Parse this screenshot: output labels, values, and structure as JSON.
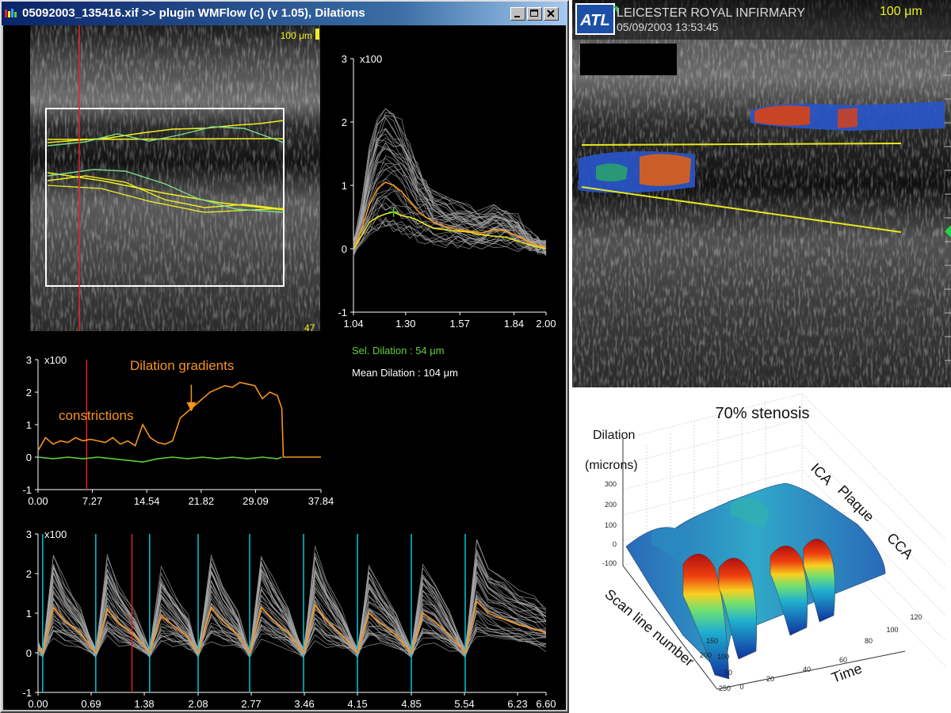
{
  "window": {
    "title": "05092003_135416.xif >> plugin WMFlow (c) (v 1.05), Dilations",
    "buttons": [
      "minimize",
      "maximize",
      "close"
    ]
  },
  "main_image": {
    "scale_label": "100 μm",
    "frame_number": "47"
  },
  "right_image": {
    "hospital": "LEICESTER ROYAL INFIRMARY",
    "datetime": "05/09/2003 13:53:45",
    "scale_label": "100 μm",
    "logo": "ATL"
  },
  "stats": {
    "selected": "Sel. Dilation : 54 μm",
    "mean": "Mean Dilation : 104 μm"
  },
  "annotations": {
    "gradients": "Dilation gradients",
    "constrictions": "constrictions"
  },
  "surface": {
    "title": "70% stenosis",
    "zlabel_line1": "Dilation",
    "zlabel_line2": "(microns)",
    "xlabel": "Scan line number",
    "ylabel": "Time",
    "region_labels": [
      "ICA",
      "Plaque",
      "CCA"
    ],
    "z_ticks": [
      "300",
      "200",
      "100",
      "0",
      "-100"
    ],
    "x_ticks": [
      "0",
      "50",
      "100",
      "150",
      "200",
      "250"
    ],
    "y_ticks": [
      "0",
      "20",
      "40",
      "60",
      "80",
      "100",
      "120"
    ]
  },
  "colors": {
    "mean_curve": "#f7931e",
    "selected_curve": "#e8e81e",
    "gate_line": "#e52222",
    "beat_marker": "#00c8d8",
    "baseline_curve": "#5fcf3a"
  },
  "chart_data": [
    {
      "type": "line",
      "axis_multiplier": "x100",
      "x_ticks": [
        "1.04",
        "1.30",
        "1.57",
        "1.84",
        "2.00"
      ],
      "y_ticks": [
        "3",
        "2",
        "1",
        "0",
        "-1"
      ],
      "xlim": [
        1.04,
        2.0
      ],
      "ylim": [
        -1,
        3
      ],
      "series": [
        {
          "x": [
            1.04,
            1.08,
            1.12,
            1.16,
            1.2,
            1.24,
            1.28,
            1.32,
            1.36,
            1.4,
            1.44,
            1.5,
            1.56,
            1.62,
            1.68,
            1.74,
            1.8,
            1.86,
            1.92,
            1.96,
            2.0
          ],
          "values": [
            0,
            0.3,
            0.7,
            0.95,
            1.05,
            1.0,
            0.9,
            0.75,
            0.6,
            0.5,
            0.42,
            0.35,
            0.3,
            0.28,
            0.25,
            0.3,
            0.28,
            0.2,
            0.1,
            0.05,
            0.02
          ]
        },
        {
          "x": [
            1.04,
            1.08,
            1.12,
            1.16,
            1.2,
            1.24,
            1.28,
            1.32,
            1.36,
            1.4,
            1.44,
            1.5,
            1.56,
            1.62,
            1.68,
            1.74,
            1.8,
            1.86,
            1.92,
            1.96,
            2.0
          ],
          "values": [
            0,
            0.2,
            0.42,
            0.5,
            0.55,
            0.58,
            0.52,
            0.5,
            0.45,
            0.38,
            0.32,
            0.3,
            0.28,
            0.26,
            0.22,
            0.2,
            0.18,
            0.12,
            0.06,
            0.03,
            0.0
          ]
        }
      ]
    },
    {
      "type": "line",
      "axis_multiplier": "x100",
      "x_ticks": [
        "0.00",
        "7.27",
        "14.54",
        "21.82",
        "29.09",
        "37.84"
      ],
      "y_ticks": [
        "3",
        "2",
        "1",
        "0",
        "-1"
      ],
      "xlim": [
        0,
        37.84
      ],
      "ylim": [
        -1,
        3
      ],
      "series": [
        {
          "x": [
            0,
            1,
            2,
            3,
            4,
            5,
            6,
            7,
            8,
            9,
            10,
            11,
            12,
            13,
            14,
            15,
            16,
            17,
            18,
            19,
            20,
            21,
            22,
            23,
            24,
            25,
            26,
            27,
            28,
            29,
            30,
            31,
            32,
            32.6,
            32.8,
            37.84
          ],
          "values": [
            0.2,
            0.6,
            0.4,
            0.5,
            0.45,
            0.6,
            0.5,
            0.55,
            0.5,
            0.45,
            0.6,
            0.4,
            0.5,
            0.35,
            1.0,
            0.6,
            0.45,
            0.4,
            0.5,
            1.2,
            1.4,
            1.6,
            1.8,
            2.0,
            2.1,
            2.2,
            2.15,
            2.3,
            2.25,
            2.2,
            1.8,
            2.0,
            1.9,
            1.5,
            0,
            0
          ]
        },
        {
          "x": [
            0,
            2,
            4,
            6,
            8,
            10,
            12,
            14,
            16,
            18,
            20,
            22,
            24,
            26,
            28,
            30,
            32,
            32.6
          ],
          "values": [
            0,
            -0.05,
            0,
            -0.05,
            0,
            -0.05,
            -0.1,
            -0.15,
            -0.05,
            0,
            -0.05,
            0,
            -0.05,
            0,
            -0.05,
            0,
            -0.05,
            0
          ]
        }
      ]
    },
    {
      "type": "line",
      "axis_multiplier": "x100",
      "x_ticks": [
        "0.00",
        "0.69",
        "1.38",
        "2.08",
        "2.77",
        "3.46",
        "4.15",
        "4.85",
        "5.54",
        "6.23",
        "6.60"
      ],
      "y_ticks": [
        "3",
        "2",
        "1",
        "0",
        "-1"
      ],
      "xlim": [
        0,
        6.6
      ],
      "ylim": [
        -1,
        3
      ],
      "beat_markers": [
        0.06,
        0.75,
        1.45,
        2.08,
        2.75,
        3.45,
        4.15,
        4.85,
        5.55
      ],
      "series": [
        {
          "x": [
            0,
            0.06,
            0.2,
            0.35,
            0.55,
            0.75,
            0.9,
            1.05,
            1.25,
            1.45,
            1.6,
            1.75,
            1.95,
            2.08,
            2.25,
            2.4,
            2.6,
            2.75,
            2.9,
            3.05,
            3.25,
            3.45,
            3.6,
            3.75,
            3.95,
            4.15,
            4.3,
            4.45,
            4.65,
            4.85,
            5.0,
            5.15,
            5.35,
            5.55,
            5.7,
            5.85,
            6.05,
            6.25,
            6.45,
            6.6
          ],
          "values": [
            0.1,
            0.0,
            1.15,
            0.8,
            0.5,
            0.0,
            1.1,
            0.75,
            0.45,
            0.0,
            0.95,
            0.7,
            0.4,
            0.0,
            1.15,
            0.8,
            0.45,
            0.0,
            1.15,
            0.85,
            0.5,
            0.0,
            1.2,
            0.8,
            0.45,
            0.0,
            1.0,
            0.75,
            0.45,
            0.0,
            1.0,
            0.8,
            0.45,
            0.0,
            1.3,
            1.0,
            0.85,
            0.7,
            0.6,
            0.5
          ]
        }
      ]
    }
  ]
}
